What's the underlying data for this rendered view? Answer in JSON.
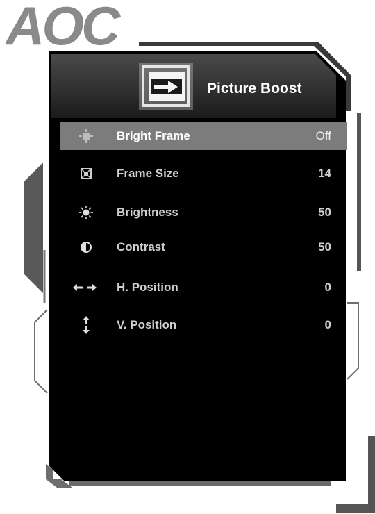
{
  "brand": {
    "logo_text": "AOC"
  },
  "header": {
    "title": "Picture Boost",
    "icon": "picture-boost-icon"
  },
  "menu": {
    "items": [
      {
        "label": "Bright Frame",
        "value": "Off",
        "icon": "bright-frame-icon",
        "selected": true
      },
      {
        "label": "Frame Size",
        "value": "14",
        "icon": "frame-size-icon",
        "selected": false
      },
      {
        "label": "Brightness",
        "value": "50",
        "icon": "brightness-icon",
        "selected": false
      },
      {
        "label": "Contrast",
        "value": "50",
        "icon": "contrast-icon",
        "selected": false
      },
      {
        "label": "H. Position",
        "value": "0",
        "icon": "horizontal-arrows-icon",
        "selected": false
      },
      {
        "label": "V. Position",
        "value": "0",
        "icon": "vertical-arrows-icon",
        "selected": false
      }
    ]
  },
  "colors": {
    "panel_bg": "#000000",
    "header_bg": "#2a2a2a",
    "selected_row": "#7c7c7c",
    "frame": "#5a5a5a"
  }
}
